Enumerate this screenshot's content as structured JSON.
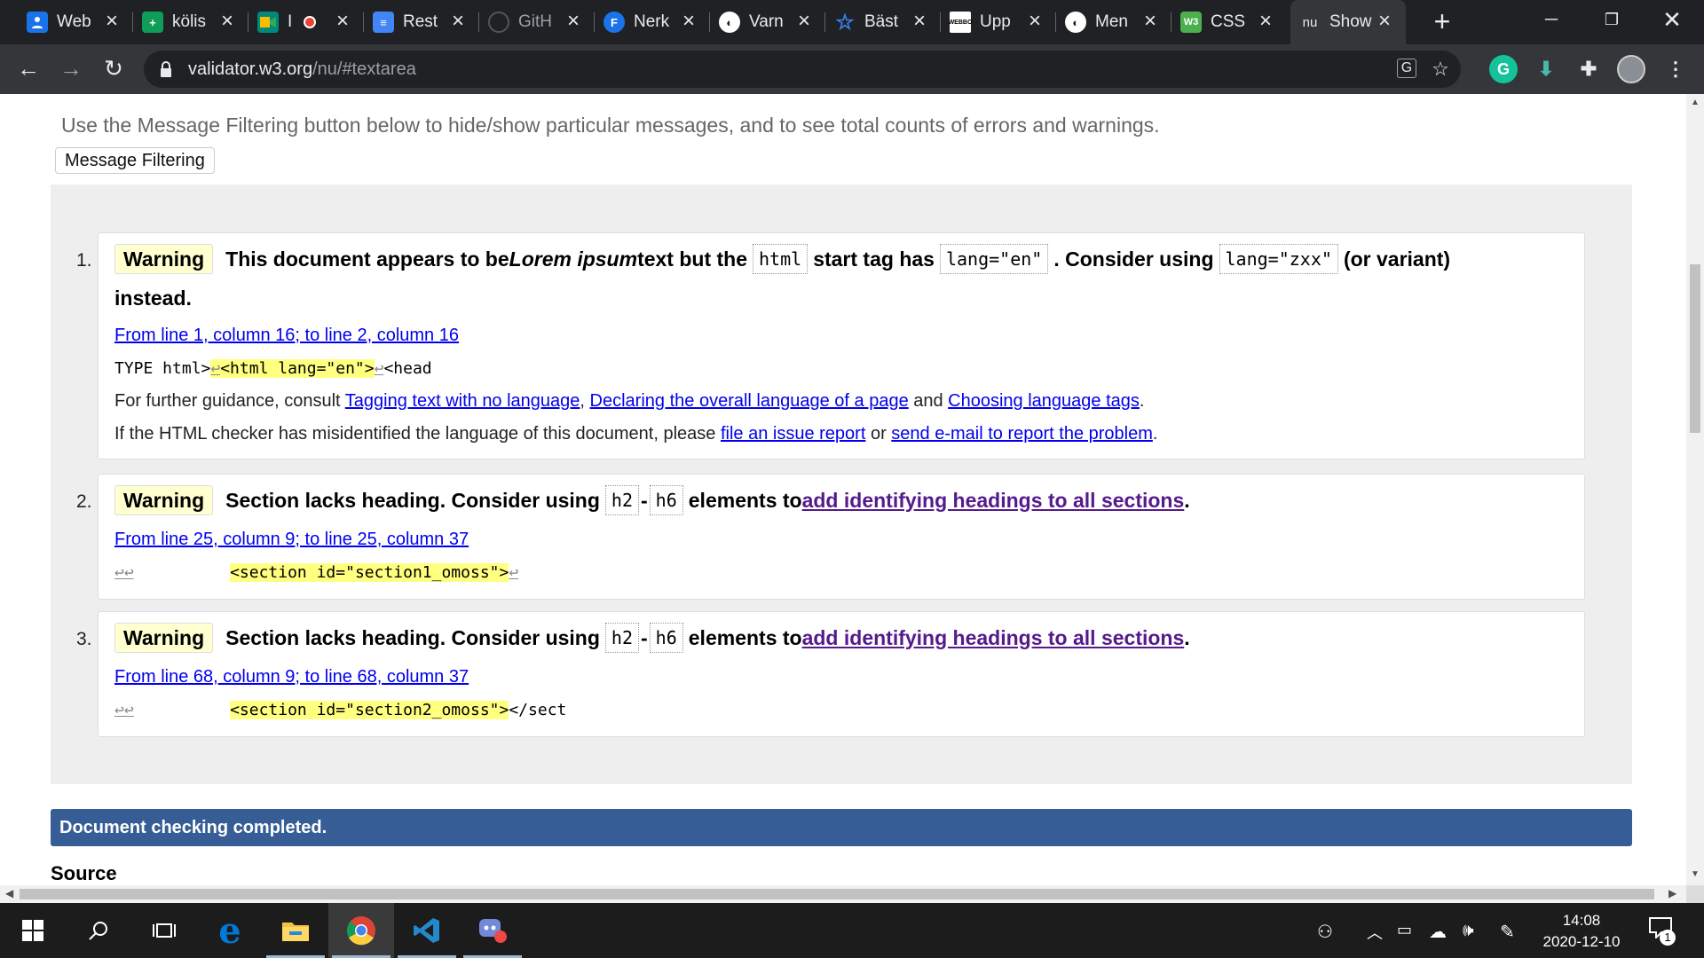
{
  "browser": {
    "tabs": [
      {
        "title": "Web",
        "icon": "user-icon",
        "color": "#1a73e8"
      },
      {
        "title": "kölis",
        "icon": "sheets-icon",
        "color": "#0f9d58"
      },
      {
        "title": "I",
        "icon": "meet-icon",
        "color": "#00897b"
      },
      {
        "title": "Rest",
        "icon": "docs-icon",
        "color": "#4285f4"
      },
      {
        "title": "GitH",
        "icon": "github-icon",
        "color": "#000000"
      },
      {
        "title": "Nerk",
        "icon": "f-icon",
        "color": "#1a73e8"
      },
      {
        "title": "Varn",
        "icon": "globe-icon",
        "color": "#ffffff"
      },
      {
        "title": "Bäst",
        "icon": "star-icon",
        "color": "#3b82f6"
      },
      {
        "title": "Upp",
        "icon": "webbo-icon",
        "color": "#ffffff"
      },
      {
        "title": "Men",
        "icon": "globe-icon",
        "color": "#ffffff"
      },
      {
        "title": "CSS",
        "icon": "w3-icon",
        "color": "#4caf50"
      },
      {
        "title": "Show",
        "icon": "nu-icon",
        "color": "#35363a"
      }
    ],
    "url_host": "validator.w3.org",
    "url_path": "/nu/#textarea"
  },
  "page": {
    "intro": "Use the Message Filtering button below to hide/show particular messages, and to see total counts of errors and warnings.",
    "filter_button": "Message Filtering",
    "messages": [
      {
        "number": "1.",
        "type": "Warning",
        "text_a": "This document appears to be ",
        "text_em": "Lorem ipsum",
        "text_b": " text but the ",
        "code1": "html",
        "text_c": " start tag has ",
        "code2": "lang=\"en\"",
        "text_d": ". Consider using ",
        "code3": "lang=\"zxx\"",
        "text_e": " (or variant)",
        "text_f": "instead.",
        "location": "From line 1, column 16; to line 2, column 16",
        "extract_pre": "TYPE html>",
        "extract_hl": "<html lang=\"en\">",
        "extract_post": "<head",
        "guidance_pre": "For further guidance, consult ",
        "guidance_link1": "Tagging text with no language",
        "guidance_sep1": ", ",
        "guidance_link2": "Declaring the overall language of a page",
        "guidance_and": " and ",
        "guidance_link3": "Choosing language tags",
        "guidance_end": ".",
        "report_pre": "If the HTML checker has misidentified the language of this document, please ",
        "report_link1": "file an issue report",
        "report_or": " or ",
        "report_link2": "send e-mail to report the problem",
        "report_end": "."
      },
      {
        "number": "2.",
        "type": "Warning",
        "text_a": "Section lacks heading. Consider using ",
        "code1": "h2",
        "dash": "-",
        "code2": "h6",
        "text_b": " elements to ",
        "link": "add identifying headings to all sections",
        "end": ".",
        "location": "From line 25, column 9; to line 25, column 37",
        "extract_hl": "<section id=\"section1_omoss\">",
        "extract_post": ""
      },
      {
        "number": "3.",
        "type": "Warning",
        "text_a": "Section lacks heading. Consider using ",
        "code1": "h2",
        "dash": "-",
        "code2": "h6",
        "text_b": " elements to ",
        "link": "add identifying headings to all sections",
        "end": ".",
        "location": "From line 68, column 9; to line 68, column 37",
        "extract_hl": "<section id=\"section2_omoss\">",
        "extract_post": "</sect"
      }
    ],
    "status": "Document checking completed.",
    "source_heading": "Source"
  },
  "taskbar": {
    "time": "14:08",
    "date": "2020-12-10",
    "notifications": "1"
  },
  "colors": {
    "tab_bg": "#202124",
    "toolbar_bg": "#35363a",
    "warning_bg": "#ffffd0",
    "highlight": "#ffff80",
    "status_bar": "#365d95",
    "link": "#0000ee",
    "visited_link": "#551a8b"
  }
}
